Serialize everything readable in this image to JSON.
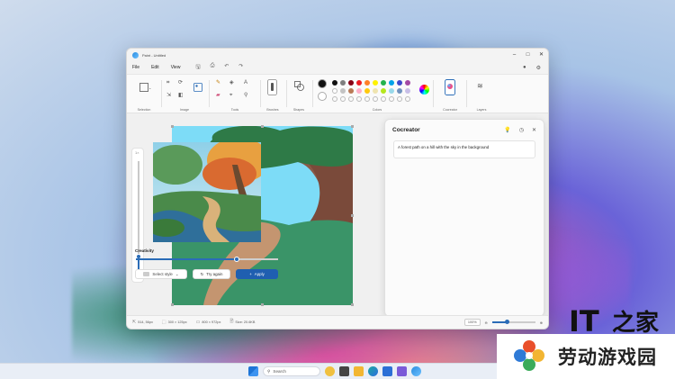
{
  "window": {
    "title": "Paint - Untitled",
    "controls": [
      "–",
      "□",
      "✕"
    ]
  },
  "menu": {
    "items": [
      "File",
      "Edit",
      "View"
    ]
  },
  "ribbon": {
    "groups": [
      "Selection",
      "Image",
      "Tools",
      "Brushes",
      "Shapes",
      "Colors",
      "Cocreator",
      "Layers"
    ],
    "swatch_colors": [
      "#111111",
      "#7f7f7f",
      "#880015",
      "#ed1c24",
      "#ff7f27",
      "#fff200",
      "#22b14c",
      "#00a2e8",
      "#3f48cc",
      "#a349a4",
      "#ffffff",
      "#c3c3c3",
      "#b97a57",
      "#ffaec9",
      "#ffc90e",
      "#efe4b0",
      "#b5e61d",
      "#99d9ea",
      "#7092be",
      "#c8bfe7"
    ],
    "active_color": "#111111"
  },
  "zoom_rail": {
    "label": "1×"
  },
  "cocreator": {
    "title": "Cocreator",
    "prompt": "A forest path on a hill with the sky in the background",
    "creativity_label": "Creativity",
    "creativity_value": 0.71,
    "select_style_label": "Select style",
    "try_again_label": "Try again",
    "apply_label": "Apply"
  },
  "status": {
    "cursor": "514, 56px",
    "selection": "300 × 125px",
    "canvas_size": "800 × 972px",
    "file_size": "Size: 20.6KB",
    "zoom_percent": "100%",
    "zoom_value": 0.35
  },
  "taskbar": {
    "search_label": "Search"
  },
  "watermark": {
    "logo_text": "IT之家",
    "site_text": "劳动游戏园"
  }
}
